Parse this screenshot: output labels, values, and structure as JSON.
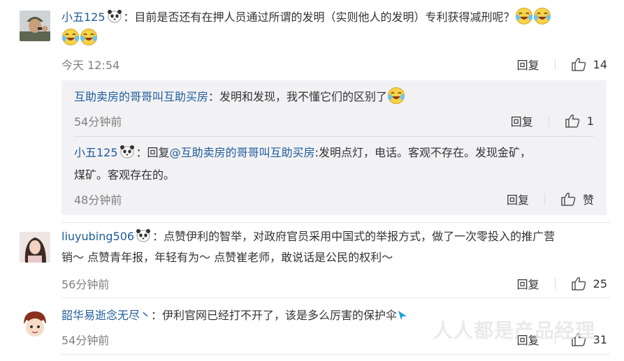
{
  "comments": [
    {
      "user": "小五125",
      "text": "：目前是否还有在押人员通过所谓的发明（实则他人的发明）专利获得减刑呢？",
      "time": "今天 12:54",
      "reply_label": "回复",
      "likes": "14",
      "replies": [
        {
          "user": "互助卖房的哥哥叫互助买房",
          "text": "：发明和发现，我不懂它们的区别了",
          "time": "54分钟前",
          "reply_label": "回复",
          "likes": "1"
        },
        {
          "user": "小五125",
          "text_prefix": "：回复",
          "mention": "@互助卖房的哥哥叫互助买房",
          "text": ":发明点灯，电话。客观不存在。发现金矿，",
          "text2": "煤矿。客观存在的。",
          "time": "48分钟前",
          "reply_label": "回复",
          "likes": "赞"
        }
      ]
    },
    {
      "user": "liuyubing506",
      "text": "：点赞伊利的智举，对政府官员采用中国式的举报方式，做了一次零投入的推广营",
      "text2": "销～ 点赞青年报，年轻有为～ 点赞崔老师，敢说话是公民的权利～",
      "time": "56分钟前",
      "reply_label": "回复",
      "likes": "25"
    },
    {
      "user": "韶华易逝念无尽丶",
      "text": "：伊利官网已经打不开了，该是多么厉害的保护伞",
      "time": "54分钟前",
      "reply_label": "回复",
      "likes": "31"
    }
  ],
  "watermark": "人人都是产品经理",
  "icons": {
    "panda": "panda-badge-icon",
    "laugh_cry": "laugh-cry-emoji-icon",
    "thumb": "thumbs-up-icon"
  },
  "colors": {
    "username": "#1f5c99",
    "text": "#333333",
    "muted": "#808080",
    "reply_bg": "#f2f2f5"
  }
}
